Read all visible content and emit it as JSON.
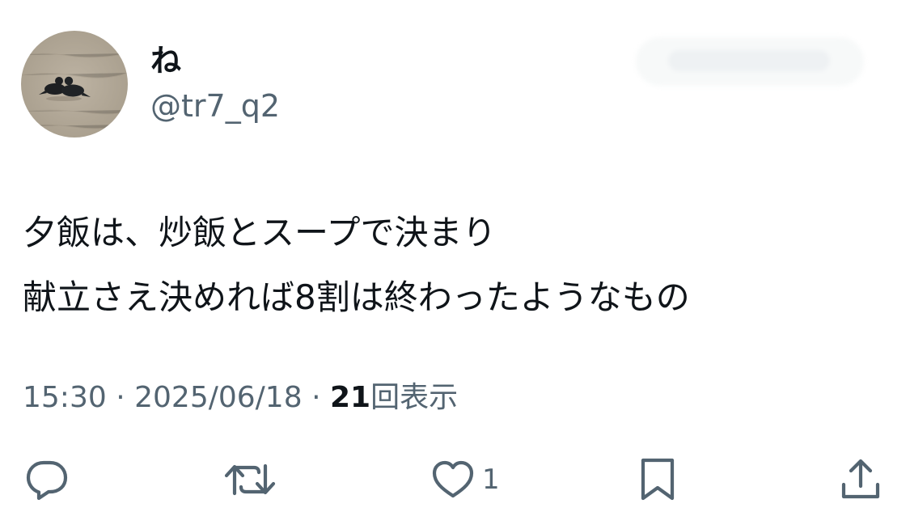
{
  "user": {
    "display_name": "ね",
    "handle": "@tr7_q2",
    "avatar_icon": "pigeons-photo-avatar"
  },
  "tweet": {
    "lines": [
      "夕飯は、炒飯とスープで決まり",
      "献立さえ決めれば8割は終わったようなもの"
    ]
  },
  "meta": {
    "time": "15:30",
    "date": "2025/06/18",
    "separator": "·",
    "views_count": "21",
    "views_label": "回表示"
  },
  "actions": {
    "reply_icon": "reply-icon",
    "retweet_icon": "retweet-icon",
    "like_icon": "like-icon",
    "like_count": "1",
    "bookmark_icon": "bookmark-icon",
    "share_icon": "share-icon"
  },
  "colors": {
    "text_primary": "#0f1419",
    "text_secondary": "#536471"
  }
}
